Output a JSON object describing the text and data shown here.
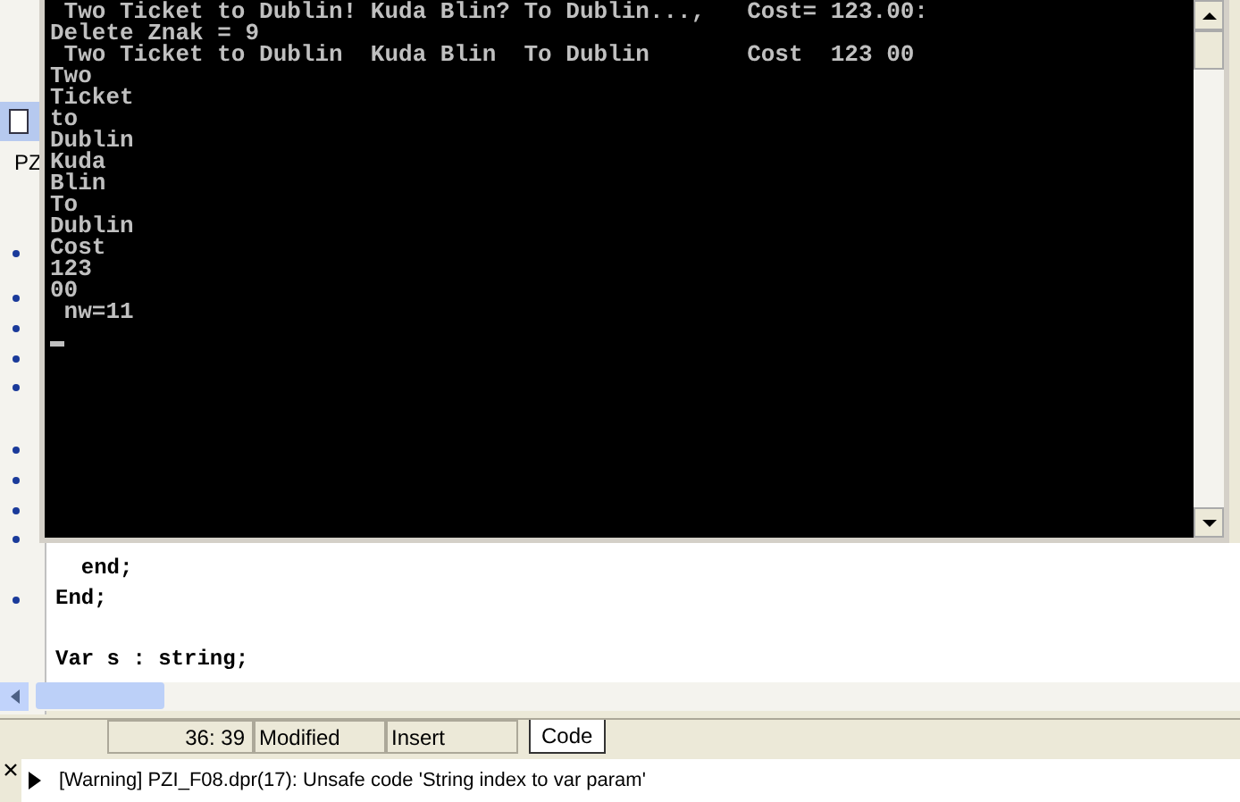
{
  "left_panel": {
    "label": "PZ"
  },
  "console": {
    "lines": [
      " Two Ticket to Dublin! Kuda Blin? To Dublin...,   Cost= 123.00:",
      "Delete Znak = 9",
      " Two Ticket to Dublin  Kuda Blin  To Dublin       Cost  123 00",
      "Two",
      "Ticket",
      "to",
      "Dublin",
      "Kuda",
      "Blin",
      "To",
      "Dublin",
      "Cost",
      "123",
      "00",
      " nw=11"
    ]
  },
  "editor": {
    "blocks": [
      {
        "lines": [
          "  end;",
          "End;"
        ]
      },
      {
        "lines": [
          "Var s : string;"
        ]
      }
    ]
  },
  "status_bar": {
    "position": "36: 39",
    "modified": "Modified",
    "mode": "Insert",
    "tabs": [
      {
        "label": "Code",
        "selected": true
      }
    ]
  },
  "messages": [
    {
      "text": "[Warning] PZI_F08.dpr(17): Unsafe code 'String index to var param'"
    }
  ]
}
